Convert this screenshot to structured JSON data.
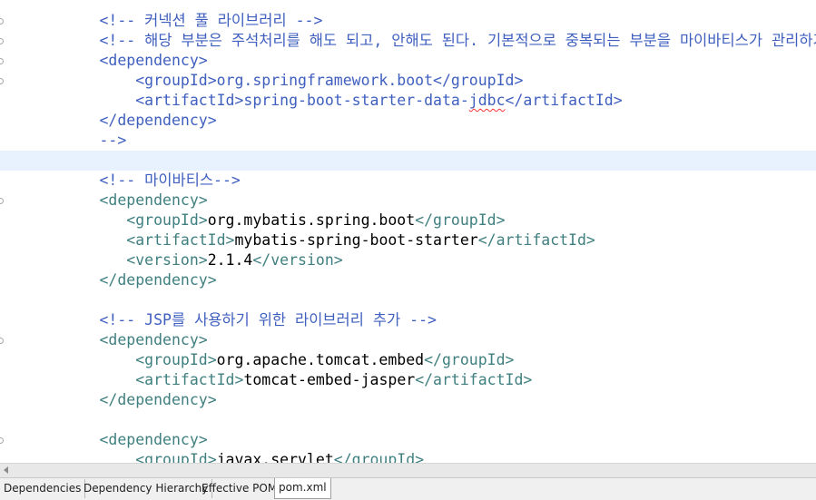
{
  "editor": {
    "lines": [
      {
        "indent": "        ",
        "segments": [
          {
            "t": "<!-- 커넥션 풀 라이브러리 -->",
            "c": "comment"
          }
        ]
      },
      {
        "indent": "        ",
        "segments": [
          {
            "t": "<!-- 해당 부분은 주석처리를 해도 되고, 안해도 된다. 기본적으로 중복되는 부분을 마이바티스가 관리하기 때문.",
            "c": "comment"
          }
        ]
      },
      {
        "indent": "        ",
        "segments": [
          {
            "t": "<dependency>",
            "c": "comment"
          }
        ]
      },
      {
        "indent": "            ",
        "segments": [
          {
            "t": "<groupId>org.springframework.boot</groupId>",
            "c": "comment"
          }
        ]
      },
      {
        "indent": "            ",
        "segments": [
          {
            "t": "<artifactId>spring-boot-starter-data-",
            "c": "comment"
          },
          {
            "t": "jdbc",
            "c": "comment squiggle"
          },
          {
            "t": "</artifactId>",
            "c": "comment"
          }
        ]
      },
      {
        "indent": "        ",
        "segments": [
          {
            "t": "</dependency>",
            "c": "comment"
          }
        ]
      },
      {
        "indent": "        ",
        "segments": [
          {
            "t": "-->",
            "c": "comment"
          }
        ]
      },
      {
        "indent": "",
        "segments": [],
        "current": true
      },
      {
        "indent": "        ",
        "segments": [
          {
            "t": "<!-- 마이바티스-->",
            "c": "comment"
          }
        ]
      },
      {
        "indent": "        ",
        "segments": [
          {
            "t": "<dependency>",
            "c": "tag"
          }
        ]
      },
      {
        "indent": "           ",
        "segments": [
          {
            "t": "<groupId>",
            "c": "tag"
          },
          {
            "t": "org.mybatis.spring.boot",
            "c": "text"
          },
          {
            "t": "</groupId>",
            "c": "tag"
          }
        ]
      },
      {
        "indent": "           ",
        "segments": [
          {
            "t": "<artifactId>",
            "c": "tag"
          },
          {
            "t": "mybatis-spring-boot-starter",
            "c": "text"
          },
          {
            "t": "</artifactId>",
            "c": "tag"
          }
        ]
      },
      {
        "indent": "           ",
        "segments": [
          {
            "t": "<version>",
            "c": "tag"
          },
          {
            "t": "2.1.4",
            "c": "text"
          },
          {
            "t": "</version>",
            "c": "tag"
          }
        ]
      },
      {
        "indent": "        ",
        "segments": [
          {
            "t": "</dependency>",
            "c": "tag"
          }
        ]
      },
      {
        "indent": "",
        "segments": []
      },
      {
        "indent": "        ",
        "segments": [
          {
            "t": "<!-- JSP를 사용하기 위한 라이브러리 추가 -->",
            "c": "comment"
          }
        ]
      },
      {
        "indent": "        ",
        "segments": [
          {
            "t": "<dependency>",
            "c": "tag"
          }
        ]
      },
      {
        "indent": "            ",
        "segments": [
          {
            "t": "<groupId>",
            "c": "tag"
          },
          {
            "t": "org.apache.tomcat.embed",
            "c": "text"
          },
          {
            "t": "</groupId>",
            "c": "tag"
          }
        ]
      },
      {
        "indent": "            ",
        "segments": [
          {
            "t": "<artifactId>",
            "c": "tag"
          },
          {
            "t": "tomcat-embed-jasper",
            "c": "text"
          },
          {
            "t": "</artifactId>",
            "c": "tag"
          }
        ]
      },
      {
        "indent": "        ",
        "segments": [
          {
            "t": "</dependency>",
            "c": "tag"
          }
        ]
      },
      {
        "indent": "",
        "segments": []
      },
      {
        "indent": "        ",
        "segments": [
          {
            "t": "<dependency>",
            "c": "tag"
          }
        ]
      },
      {
        "indent": "            ",
        "segments": [
          {
            "t": "<groupId>",
            "c": "tag"
          },
          {
            "t": "javax.servlet",
            "c": "text"
          },
          {
            "t": "</groupId>",
            "c": "tag"
          }
        ]
      }
    ],
    "markers_on_lines": [
      0,
      1,
      2,
      3,
      9,
      16,
      21
    ]
  },
  "tabs": [
    {
      "label": "Dependencies",
      "active": false
    },
    {
      "label": "Dependency Hierarchy",
      "active": false
    },
    {
      "label": "Effective POM",
      "active": false
    },
    {
      "label": "pom.xml",
      "active": true
    }
  ],
  "colors": {
    "comment": "#3f5fbf",
    "tag": "#3f7f7f",
    "text": "#000000",
    "current_line": "#e8f2fe"
  }
}
